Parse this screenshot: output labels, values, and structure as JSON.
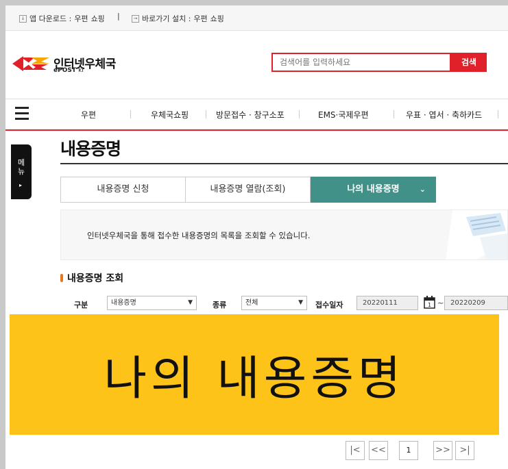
{
  "topbar": {
    "app_download_label": "앱 다운로드 :",
    "app_links": [
      "우편",
      "쇼핑"
    ],
    "shortcut_label": "바로가기 설치 :",
    "shortcut_links": [
      "우편",
      "쇼핑"
    ],
    "separator": "|"
  },
  "logo": {
    "title": "인터넷우체국",
    "sub_bold": "ePOST",
    "sub_light": "kr"
  },
  "search": {
    "placeholder": "검색어를 입력하세요",
    "button_label": "검색"
  },
  "nav": {
    "items": [
      "우편",
      "우체국쇼핑",
      "방문접수 · 창구소포",
      "EMS·국제우편",
      "우표 · 엽서 · 축하카드"
    ]
  },
  "sidetab": {
    "label": "메뉴",
    "arrow": "▸"
  },
  "page": {
    "title": "내용증명"
  },
  "tabs": [
    {
      "label": "내용증명 신청"
    },
    {
      "label": "내용증명 열람(조회)"
    },
    {
      "label": "나의 내용증명",
      "active": true,
      "chevron": "⌄"
    }
  ],
  "info": {
    "text": "인터넷우체국을 통해 접수한 내용증명의 목록을 조회할 수 있습니다."
  },
  "section": {
    "title": "내용증명 조회"
  },
  "search_form": {
    "type_label": "구분",
    "type_value": "내용증명",
    "kind_label": "종류",
    "kind_value": "전체",
    "date_label": "접수일자",
    "date_from": "20220111",
    "date_to": "20220209",
    "tilde": "~"
  },
  "overlay": {
    "text": "나의 내용증명"
  },
  "pagination": {
    "first": "|<",
    "prev": "<<",
    "current_page": "1",
    "next": ">>",
    "last": ">|"
  },
  "colors": {
    "brand_red": "#e12129",
    "teal": "#419188",
    "banner_yellow": "#fdc319",
    "bullet_orange": "#e8761a"
  }
}
